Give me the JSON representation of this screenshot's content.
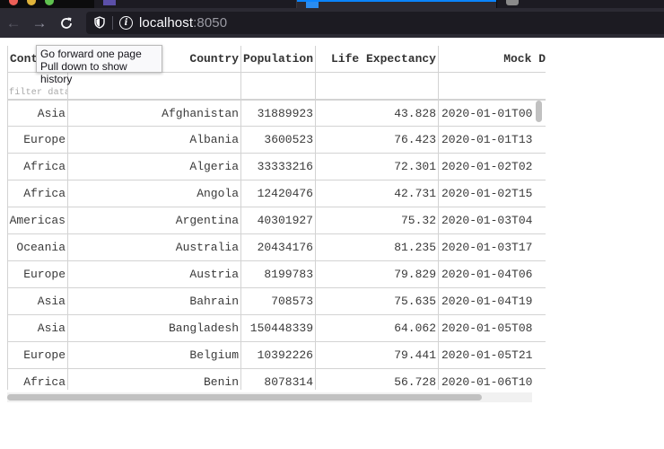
{
  "browser": {
    "url_host": "localhost",
    "url_port": ":8050",
    "tooltip_lines": [
      "Go forward one page",
      "Pull down to show history"
    ]
  },
  "table": {
    "columns": [
      "Continent",
      "Country",
      "Population",
      "Life Expectancy",
      "Mock Date"
    ],
    "visible_column_headers": [
      "Cont",
      "Country",
      "Population",
      "Life Expectancy",
      "Mock D"
    ],
    "filter_placeholder": "filter data...",
    "rows": [
      [
        "Asia",
        "Afghanistan",
        "31889923",
        "43.828",
        "2020-01-01T00"
      ],
      [
        "Europe",
        "Albania",
        "3600523",
        "76.423",
        "2020-01-01T13"
      ],
      [
        "Africa",
        "Algeria",
        "33333216",
        "72.301",
        "2020-01-02T02"
      ],
      [
        "Africa",
        "Angola",
        "12420476",
        "42.731",
        "2020-01-02T15"
      ],
      [
        "Americas",
        "Argentina",
        "40301927",
        "75.32",
        "2020-01-03T04"
      ],
      [
        "Oceania",
        "Australia",
        "20434176",
        "81.235",
        "2020-01-03T17"
      ],
      [
        "Europe",
        "Austria",
        "8199783",
        "79.829",
        "2020-01-04T06"
      ],
      [
        "Asia",
        "Bahrain",
        "708573",
        "75.635",
        "2020-01-04T19"
      ],
      [
        "Asia",
        "Bangladesh",
        "150448339",
        "64.062",
        "2020-01-05T08"
      ],
      [
        "Europe",
        "Belgium",
        "10392226",
        "79.441",
        "2020-01-05T21"
      ],
      [
        "Africa",
        "Benin",
        "8078314",
        "56.728",
        "2020-01-06T10"
      ]
    ]
  },
  "icons": {
    "back": "arrow-left-icon",
    "forward": "arrow-right-icon",
    "reload": "reload-icon",
    "tracking": "shield-icon",
    "site_info": "info-icon"
  },
  "colors": {
    "toolbar": "#2b2a33",
    "urlbar": "#1c1b22",
    "active_tab_accent": "#0a84ff",
    "grid_border": "#d3d3d3"
  }
}
